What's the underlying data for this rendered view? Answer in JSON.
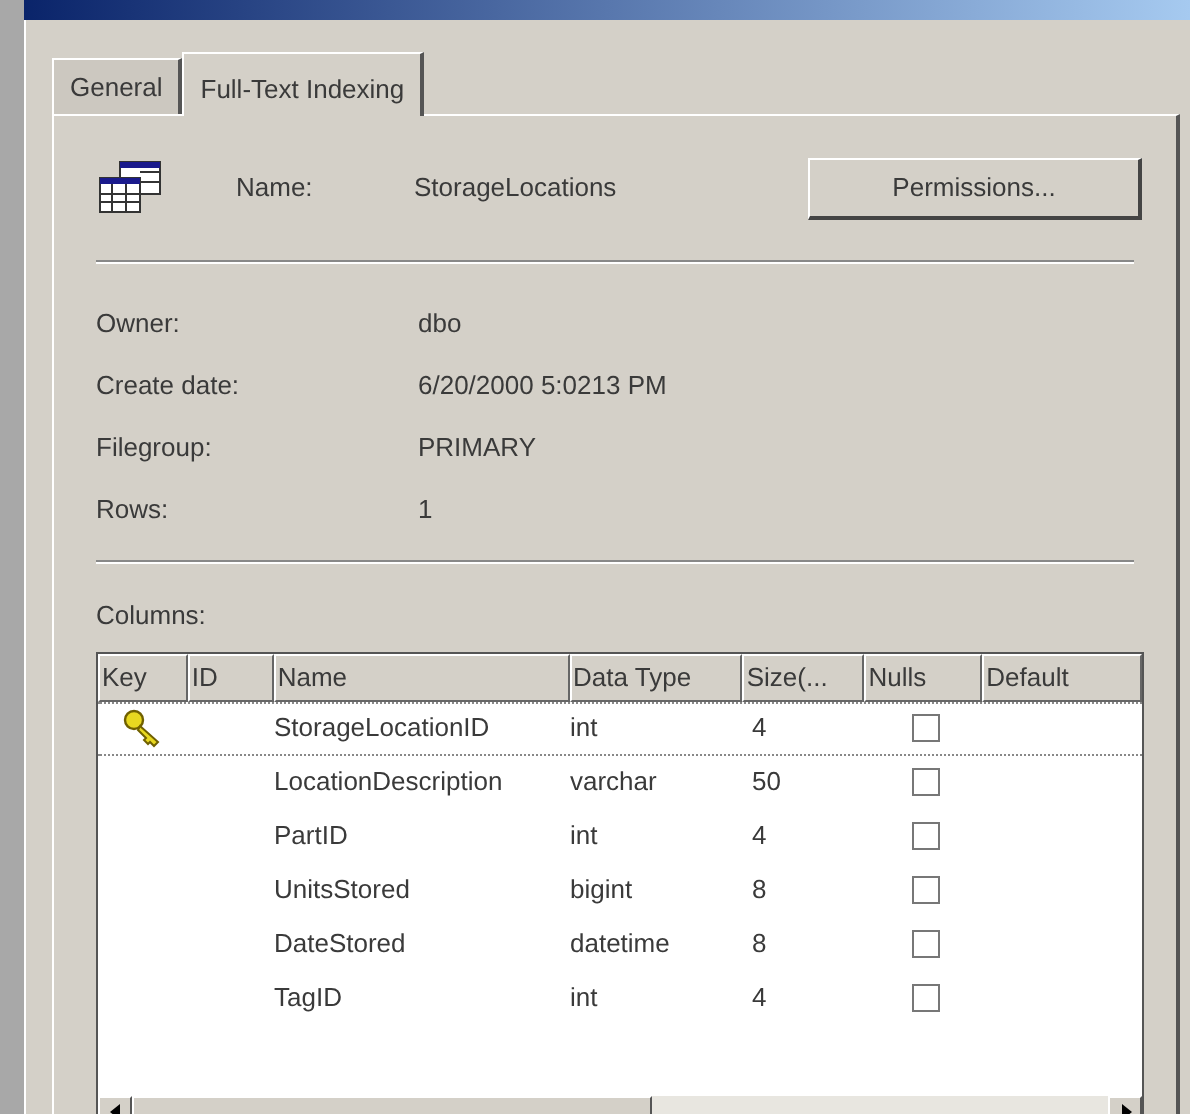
{
  "tabs": [
    {
      "label": "General",
      "selected": false
    },
    {
      "label": "Full-Text Indexing",
      "selected": true
    }
  ],
  "name": {
    "label": "Name:",
    "value": "StorageLocations"
  },
  "permissions_button": "Permissions...",
  "properties": [
    {
      "label": "Owner:",
      "value": "dbo"
    },
    {
      "label": "Create date:",
      "value": "6/20/2000 5:0213 PM"
    },
    {
      "label": "Filegroup:",
      "value": "PRIMARY"
    },
    {
      "label": "Rows:",
      "value": "1"
    }
  ],
  "columns_label": "Columns:",
  "table": {
    "columns": [
      "Key",
      "ID",
      "Name",
      "Data Type",
      "Size(...",
      "Nulls",
      "Default"
    ],
    "rows": [
      {
        "key": true,
        "name": "StorageLocationID",
        "data_type": "int",
        "size": "4",
        "nulls": false,
        "selected": true
      },
      {
        "key": false,
        "name": "LocationDescription",
        "data_type": "varchar",
        "size": "50",
        "nulls": false,
        "selected": false
      },
      {
        "key": false,
        "name": "PartID",
        "data_type": "int",
        "size": "4",
        "nulls": false,
        "selected": false
      },
      {
        "key": false,
        "name": "UnitsStored",
        "data_type": "bigint",
        "size": "8",
        "nulls": false,
        "selected": false
      },
      {
        "key": false,
        "name": "DateStored",
        "data_type": "datetime",
        "size": "8",
        "nulls": false,
        "selected": false
      },
      {
        "key": false,
        "name": "TagID",
        "data_type": "int",
        "size": "4",
        "nulls": false,
        "selected": false
      }
    ]
  }
}
